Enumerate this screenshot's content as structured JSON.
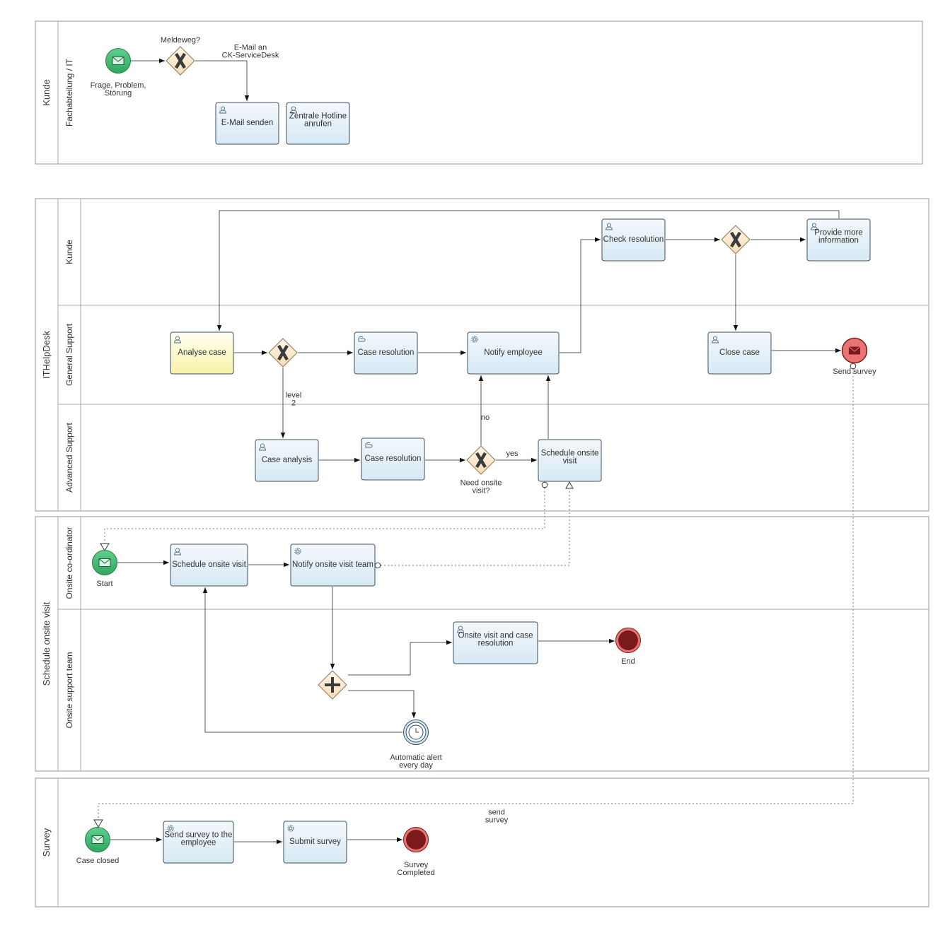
{
  "pools": [
    {
      "id": "p1",
      "label": "Kunde",
      "lanes": [
        {
          "label": "Fachabteilung / IT"
        }
      ]
    },
    {
      "id": "p2",
      "label": "ITHelpDesk",
      "lanes": [
        {
          "label": "Kunde"
        },
        {
          "label": "General Support"
        },
        {
          "label": "Advanced Support"
        }
      ]
    },
    {
      "id": "p3",
      "label": "Schedule onsite visit",
      "lanes": [
        {
          "label": "Onsite co-ordinator"
        },
        {
          "label": "Onsite support team"
        }
      ]
    },
    {
      "id": "p4",
      "label": "Survey",
      "lanes": []
    }
  ],
  "tasks": [
    {
      "id": "email",
      "label": [
        "E-Mail senden"
      ],
      "icon": "user-icon",
      "style": "blue"
    },
    {
      "id": "hotline",
      "label": [
        "Zentrale Hotline",
        "anrufen"
      ],
      "icon": "user-icon",
      "style": "blue"
    },
    {
      "id": "analyse",
      "label": [
        "Analyse case"
      ],
      "icon": "user-icon",
      "style": "yellow"
    },
    {
      "id": "caseres1",
      "label": [
        "Case resolution"
      ],
      "icon": "hand-icon",
      "style": "blue"
    },
    {
      "id": "notify",
      "label": [
        "Notify employee"
      ],
      "icon": "gear-icon",
      "style": "blue"
    },
    {
      "id": "check",
      "label": [
        "Check resolution"
      ],
      "icon": "user-icon",
      "style": "blue"
    },
    {
      "id": "provide",
      "label": [
        "Provide more",
        "information"
      ],
      "icon": "user-icon",
      "style": "blue"
    },
    {
      "id": "close",
      "label": [
        "Close case"
      ],
      "icon": "user-icon",
      "style": "blue"
    },
    {
      "id": "caseanalysis",
      "label": [
        "Case analysis"
      ],
      "icon": "user-icon",
      "style": "blue"
    },
    {
      "id": "caseres2",
      "label": [
        "Case resolution"
      ],
      "icon": "hand-icon",
      "style": "blue"
    },
    {
      "id": "schedule1",
      "label": [
        "Schedule onsite",
        "visit"
      ],
      "icon": "none",
      "style": "blue"
    },
    {
      "id": "schedule2",
      "label": [
        "Schedule onsite visit"
      ],
      "icon": "user-icon",
      "style": "blue"
    },
    {
      "id": "notifyteam",
      "label": [
        "Notify onsite visit team"
      ],
      "icon": "gear-icon",
      "style": "blue"
    },
    {
      "id": "onsite",
      "label": [
        "Onsite visit and case",
        "resolution"
      ],
      "icon": "user-icon",
      "style": "blue"
    },
    {
      "id": "sendsurvey",
      "label": [
        "Send survey to the",
        "employee"
      ],
      "icon": "gear-icon",
      "style": "blue"
    },
    {
      "id": "submit",
      "label": [
        "Submit survey"
      ],
      "icon": "gear-icon",
      "style": "blue"
    }
  ],
  "events": [
    {
      "id": "start1",
      "type": "message-start",
      "label": [
        "Frage, Problem,",
        "Störung"
      ]
    },
    {
      "id": "sendsurvey_end",
      "type": "message-end",
      "label": [
        "Send survey"
      ]
    },
    {
      "id": "start2",
      "type": "message-start",
      "label": [
        "Start"
      ]
    },
    {
      "id": "end1",
      "type": "end",
      "label": [
        "End"
      ]
    },
    {
      "id": "timer",
      "type": "timer-intermediate",
      "label": [
        "Automatic alert",
        "every day"
      ]
    },
    {
      "id": "start3",
      "type": "message-start",
      "label": [
        "Case closed"
      ]
    },
    {
      "id": "end2",
      "type": "end",
      "label": [
        "Survey",
        "Completed"
      ]
    }
  ],
  "gateways": [
    {
      "id": "gw1",
      "type": "exclusive",
      "label": [
        "Meldeweg?"
      ]
    },
    {
      "id": "gw2",
      "type": "exclusive",
      "label": []
    },
    {
      "id": "gw3",
      "type": "exclusive",
      "label": []
    },
    {
      "id": "gw4",
      "type": "exclusive",
      "label": [
        "Need onsite",
        "visit?"
      ]
    },
    {
      "id": "gw5",
      "type": "parallel",
      "label": []
    }
  ],
  "flow_labels": {
    "email_path": [
      "E-Mail an",
      "CK-ServiceDesk"
    ],
    "level2": [
      "level",
      "2"
    ],
    "no": [
      "no"
    ],
    "yes": [
      "yes"
    ],
    "send_survey": [
      "send",
      "survey"
    ]
  },
  "colors": {
    "task_fill_top": "#f4f8fb",
    "task_fill_bottom": "#d6e9f5",
    "task_yellow_top": "#fffff0",
    "task_yellow_bottom": "#f6f2a8",
    "start_fill": "#3cb371",
    "end_fill": "#7a1a1a",
    "end_ring": "#e57373",
    "gateway_fill": "#fbe6c4"
  }
}
